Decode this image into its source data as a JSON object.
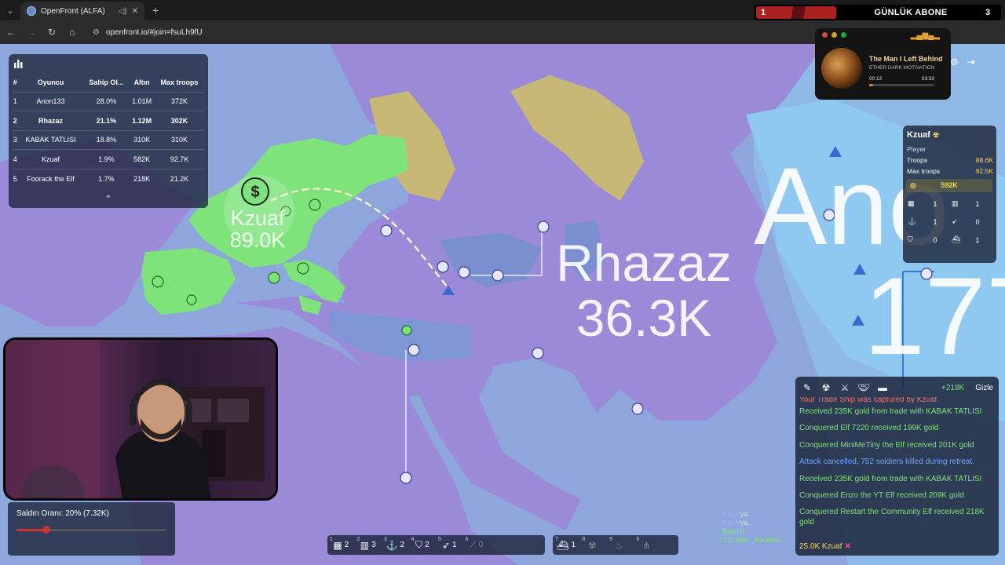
{
  "browser": {
    "tab_title": "OpenFront (ALFA)",
    "url": "openfront.io/#join=fsuLh9fU",
    "banner": {
      "left": "1",
      "text": "GÜNLÜK ABONE",
      "right": "3"
    }
  },
  "map_labels": {
    "kzuaf": {
      "name": "Kzuaf",
      "troops": "89.0K"
    },
    "rhazaz": {
      "name": "Rhazaz",
      "troops": "36.3K"
    },
    "anon_partial": {
      "name": "Ano",
      "troops": "177"
    }
  },
  "leaderboard": {
    "headers": [
      "#",
      "Oyuncu",
      "Sahip Ol...",
      "Altın",
      "Max troops"
    ],
    "rows": [
      {
        "rank": "1",
        "name": "Anon133",
        "owned": "28.0%",
        "gold": "1.01M",
        "troops": "372K"
      },
      {
        "rank": "2",
        "name": "Rhazaz",
        "owned": "21.1%",
        "gold": "1.12M",
        "troops": "302K"
      },
      {
        "rank": "3",
        "name": "KABAK TATLISI",
        "owned": "18.8%",
        "gold": "310K",
        "troops": "310K"
      },
      {
        "rank": "4",
        "name": "Kzuaf",
        "owned": "1.9%",
        "gold": "582K",
        "troops": "92.7K"
      },
      {
        "rank": "5",
        "name": "Foorack the Elf",
        "owned": "1.7%",
        "gold": "218K",
        "troops": "21.2K"
      }
    ],
    "more": "+"
  },
  "player_panel": {
    "name": "Kzuaf",
    "role": "Player",
    "troops_label": "Troops",
    "troops": "88.6K",
    "max_troops_label": "Max troops",
    "max_troops": "92.5K",
    "gold": "592K",
    "buildings": [
      {
        "icon": "city-icon",
        "count": "1"
      },
      {
        "icon": "factory-icon",
        "count": "1"
      },
      {
        "icon": "port-icon",
        "count": "1"
      },
      {
        "icon": "missile-silo-icon",
        "count": "0"
      },
      {
        "icon": "defense-post-icon",
        "count": "0"
      },
      {
        "icon": "warship-icon",
        "count": "1"
      }
    ]
  },
  "events": {
    "gold_delta": "+218K",
    "hide_label": "Gizle",
    "items": [
      {
        "text": "Your Trade Ship was captured by Kzuaf",
        "tone": "red"
      },
      {
        "text": "Received 235K gold from trade with KABAK TATLISI",
        "tone": "green"
      },
      {
        "text": "Conquered Elf 7220 received 199K gold",
        "tone": "green"
      },
      {
        "text": "Conquered MiniMeTiny the Elf received 201K gold",
        "tone": "green"
      },
      {
        "text": "Attack cancelled, 752 soldiers killed during retreat.",
        "tone": "blue"
      },
      {
        "text": "Received 235K gold from trade with KABAK TATLISI",
        "tone": "green"
      },
      {
        "text": "Conquered Enzo the YT Elf received 209K gold",
        "tone": "green"
      },
      {
        "text": "Conquered Restart the Community Elf received 218K gold",
        "tone": "green"
      }
    ],
    "footer": "25.0K Kzuaf"
  },
  "attack": {
    "label": "Saldırı Oranı: 20% (7.32K)",
    "ratio_percent": 20
  },
  "build_bar": [
    {
      "key": "1",
      "icon": "city-icon",
      "count": "2"
    },
    {
      "key": "2",
      "icon": "factory-icon",
      "count": "3"
    },
    {
      "key": "3",
      "icon": "port-icon",
      "count": "2"
    },
    {
      "key": "4",
      "icon": "defense-post-icon",
      "count": "2"
    },
    {
      "key": "5",
      "icon": "missile-silo-icon",
      "count": "1"
    },
    {
      "key": "6",
      "icon": "sam-launcher-icon",
      "count": "0"
    },
    {
      "key": "7",
      "icon": "warship-icon",
      "count": "1"
    },
    {
      "key": "8",
      "icon": "nuke-icon",
      "count": ""
    },
    {
      "key": "9",
      "icon": "hydrogen-bomb-icon",
      "count": ""
    },
    {
      "key": "0",
      "icon": "mirv-icon",
      "count": ""
    }
  ],
  "music": {
    "title": "The Man I Left Behind",
    "artist": "ETHER DARK MOTIVATION",
    "elapsed": "00:13",
    "total": "03:33",
    "progress_fraction": 0.06
  },
  "chat": {
    "lines": [
      {
        "name": "Kzuaf",
        "suffix": "ya."
      },
      {
        "name": "Kzuaf",
        "suffix": "ya."
      },
      {
        "name": "BateN1:",
        "suffix": ""
      },
      {
        "name": "31Ceken_Nautilus:",
        "suffix": ""
      }
    ]
  },
  "colors": {
    "sea": "#8ea6dc",
    "kzuaf": "#7ee37a",
    "rhazaz": "#9a8ad8",
    "anon": "#8fc8f0",
    "neutral_land": "#c8b878",
    "panel_bg": "#1c243a"
  }
}
